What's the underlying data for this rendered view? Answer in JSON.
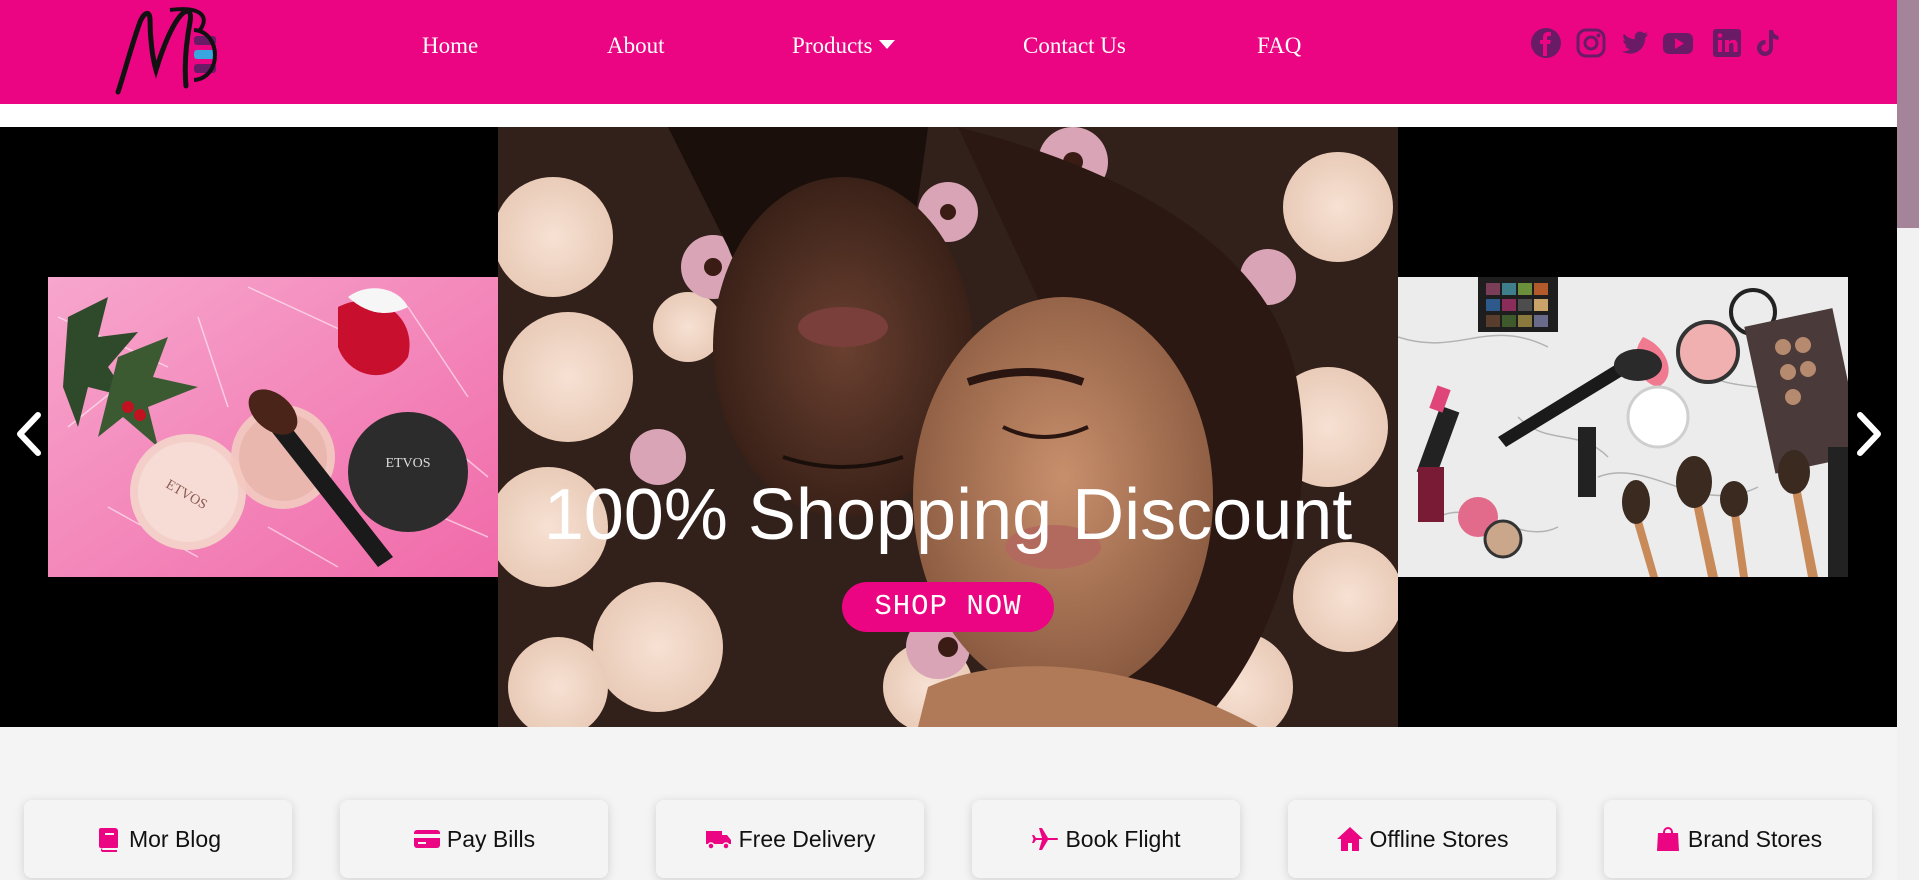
{
  "brand": {
    "logo_icon": "mb-monogram-logo",
    "accent": "#ec0582",
    "social_color": "#6a1b66"
  },
  "nav": {
    "items": [
      {
        "label": "Home"
      },
      {
        "label": "About"
      },
      {
        "label": "Products",
        "has_dropdown": true
      },
      {
        "label": "Contact Us"
      },
      {
        "label": "FAQ"
      }
    ]
  },
  "social": {
    "icons": [
      "facebook-icon",
      "instagram-icon",
      "twitter-icon",
      "youtube-icon",
      "linkedin-icon",
      "tiktok-icon"
    ]
  },
  "hero": {
    "title": "100% Shopping Discount",
    "cta_label": "SHOP NOW",
    "prev_icon": "chevron-left-icon",
    "next_icon": "chevron-right-icon"
  },
  "services": [
    {
      "label": "Mor Blog",
      "icon": "book-icon"
    },
    {
      "label": "Pay Bills",
      "icon": "credit-card-icon"
    },
    {
      "label": "Free Delivery",
      "icon": "truck-icon"
    },
    {
      "label": "Book Flight",
      "icon": "plane-icon"
    },
    {
      "label": "Offline Stores",
      "icon": "home-icon"
    },
    {
      "label": "Brand Stores",
      "icon": "shopping-bag-icon"
    }
  ]
}
